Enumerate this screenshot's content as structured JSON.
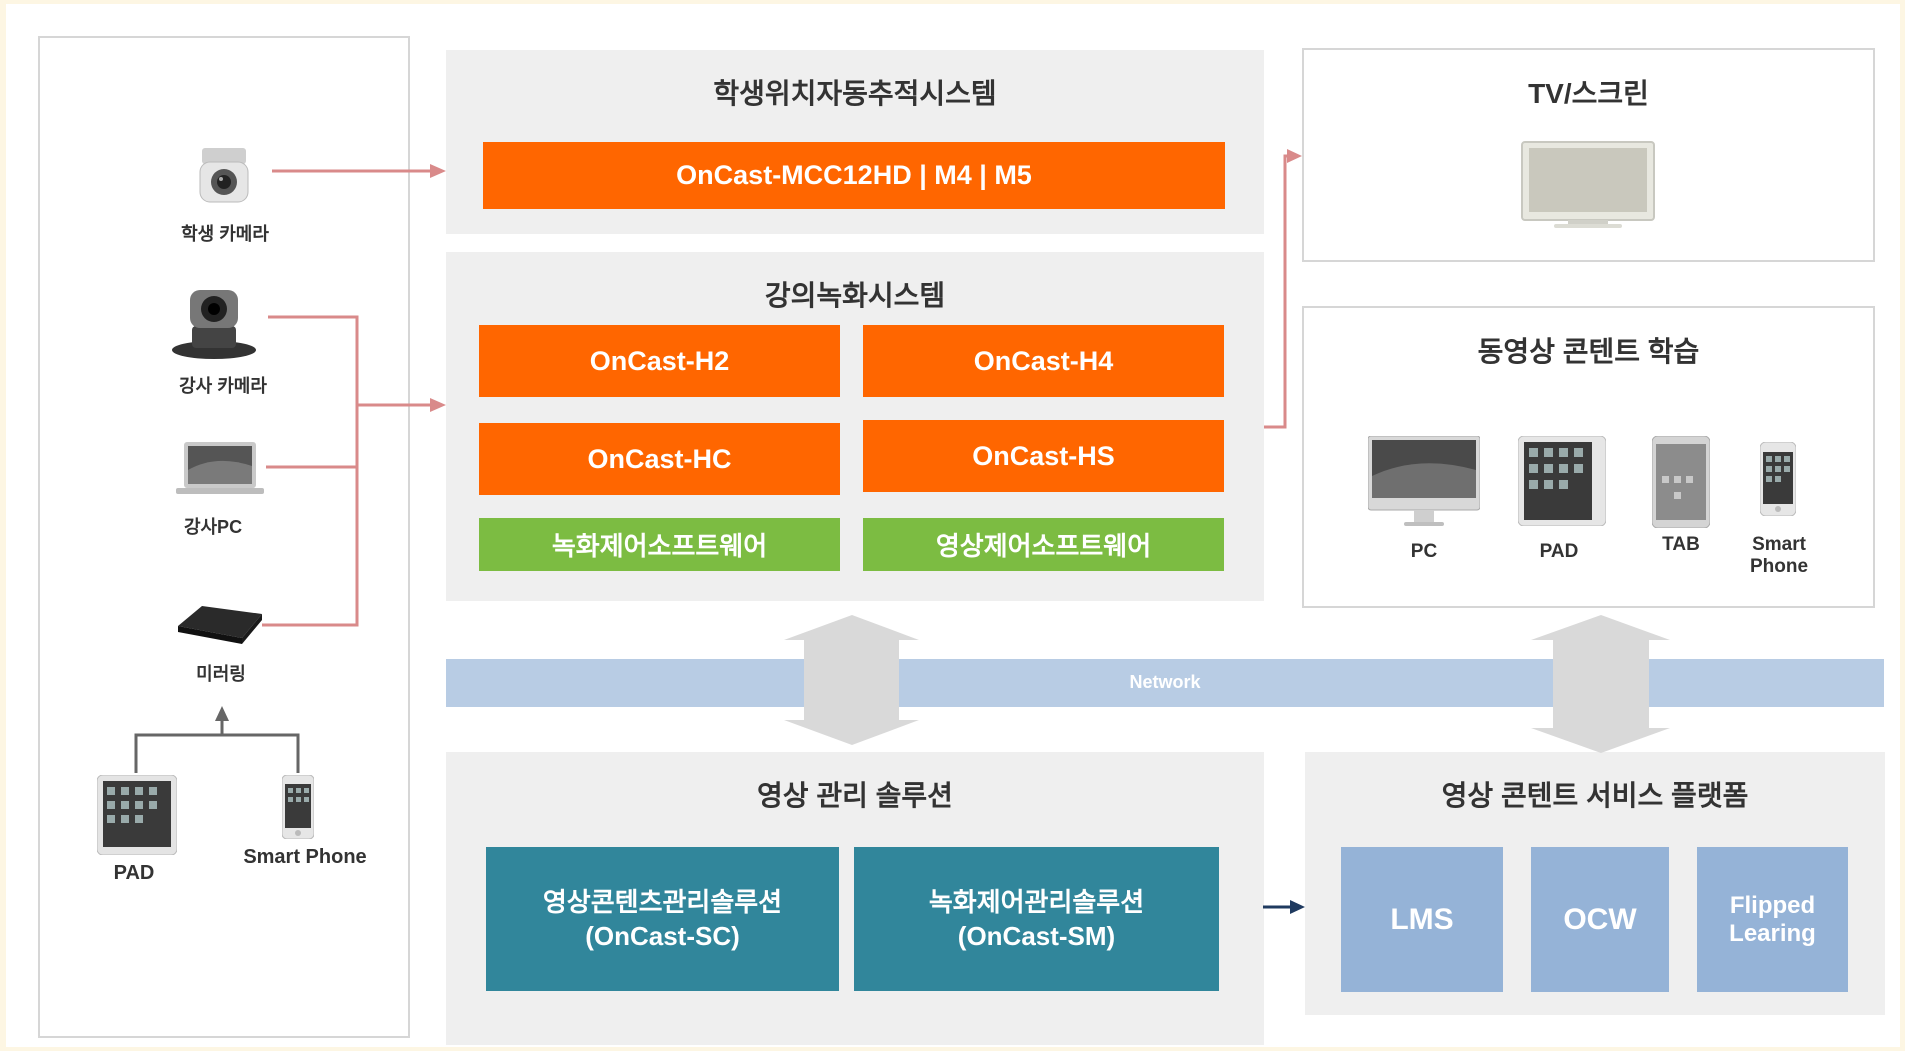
{
  "left_panel": {
    "student_camera": "학생 카메라",
    "lecturer_camera": "강사 카메라",
    "lecturer_pc": "강사PC",
    "mirroring": "미러링",
    "pad": "PAD",
    "smart_phone": "Smart Phone"
  },
  "tracking": {
    "title": "학생위치자동추적시스템",
    "product": "OnCast-MCC12HD | M4 | M5"
  },
  "recording": {
    "title": "강의녹화시스템",
    "h2": "OnCast-H2",
    "h4": "OnCast-H4",
    "hc": "OnCast-HC",
    "hs": "OnCast-HS",
    "rec_sw": "녹화제어소프트웨어",
    "video_sw": "영상제어소프트웨어"
  },
  "tv": {
    "title": "TV/스크린"
  },
  "learning": {
    "title": "동영상 콘텐트 학습",
    "pc": "PC",
    "pad": "PAD",
    "tab": "TAB",
    "smart_phone_1": "Smart",
    "smart_phone_2": "Phone"
  },
  "network": {
    "label": "Network"
  },
  "management": {
    "title": "영상 관리 솔루션",
    "sc_line1": "영상콘텐츠관리솔루션",
    "sc_line2": "(OnCast-SC)",
    "sm_line1": "녹화제어관리솔루션",
    "sm_line2": "(OnCast-SM)"
  },
  "service": {
    "title": "영상 콘텐트 서비스 플랫폼",
    "lms": "LMS",
    "ocw": "OCW",
    "flipped_1": "Flipped",
    "flipped_2": "Learing"
  },
  "colors": {
    "orange": "#ff6600",
    "green": "#7cbc42",
    "teal": "#31869b",
    "light_blue": "#95b3d7",
    "network": "#b8cce4",
    "arrow_pink": "#d98a8a"
  }
}
